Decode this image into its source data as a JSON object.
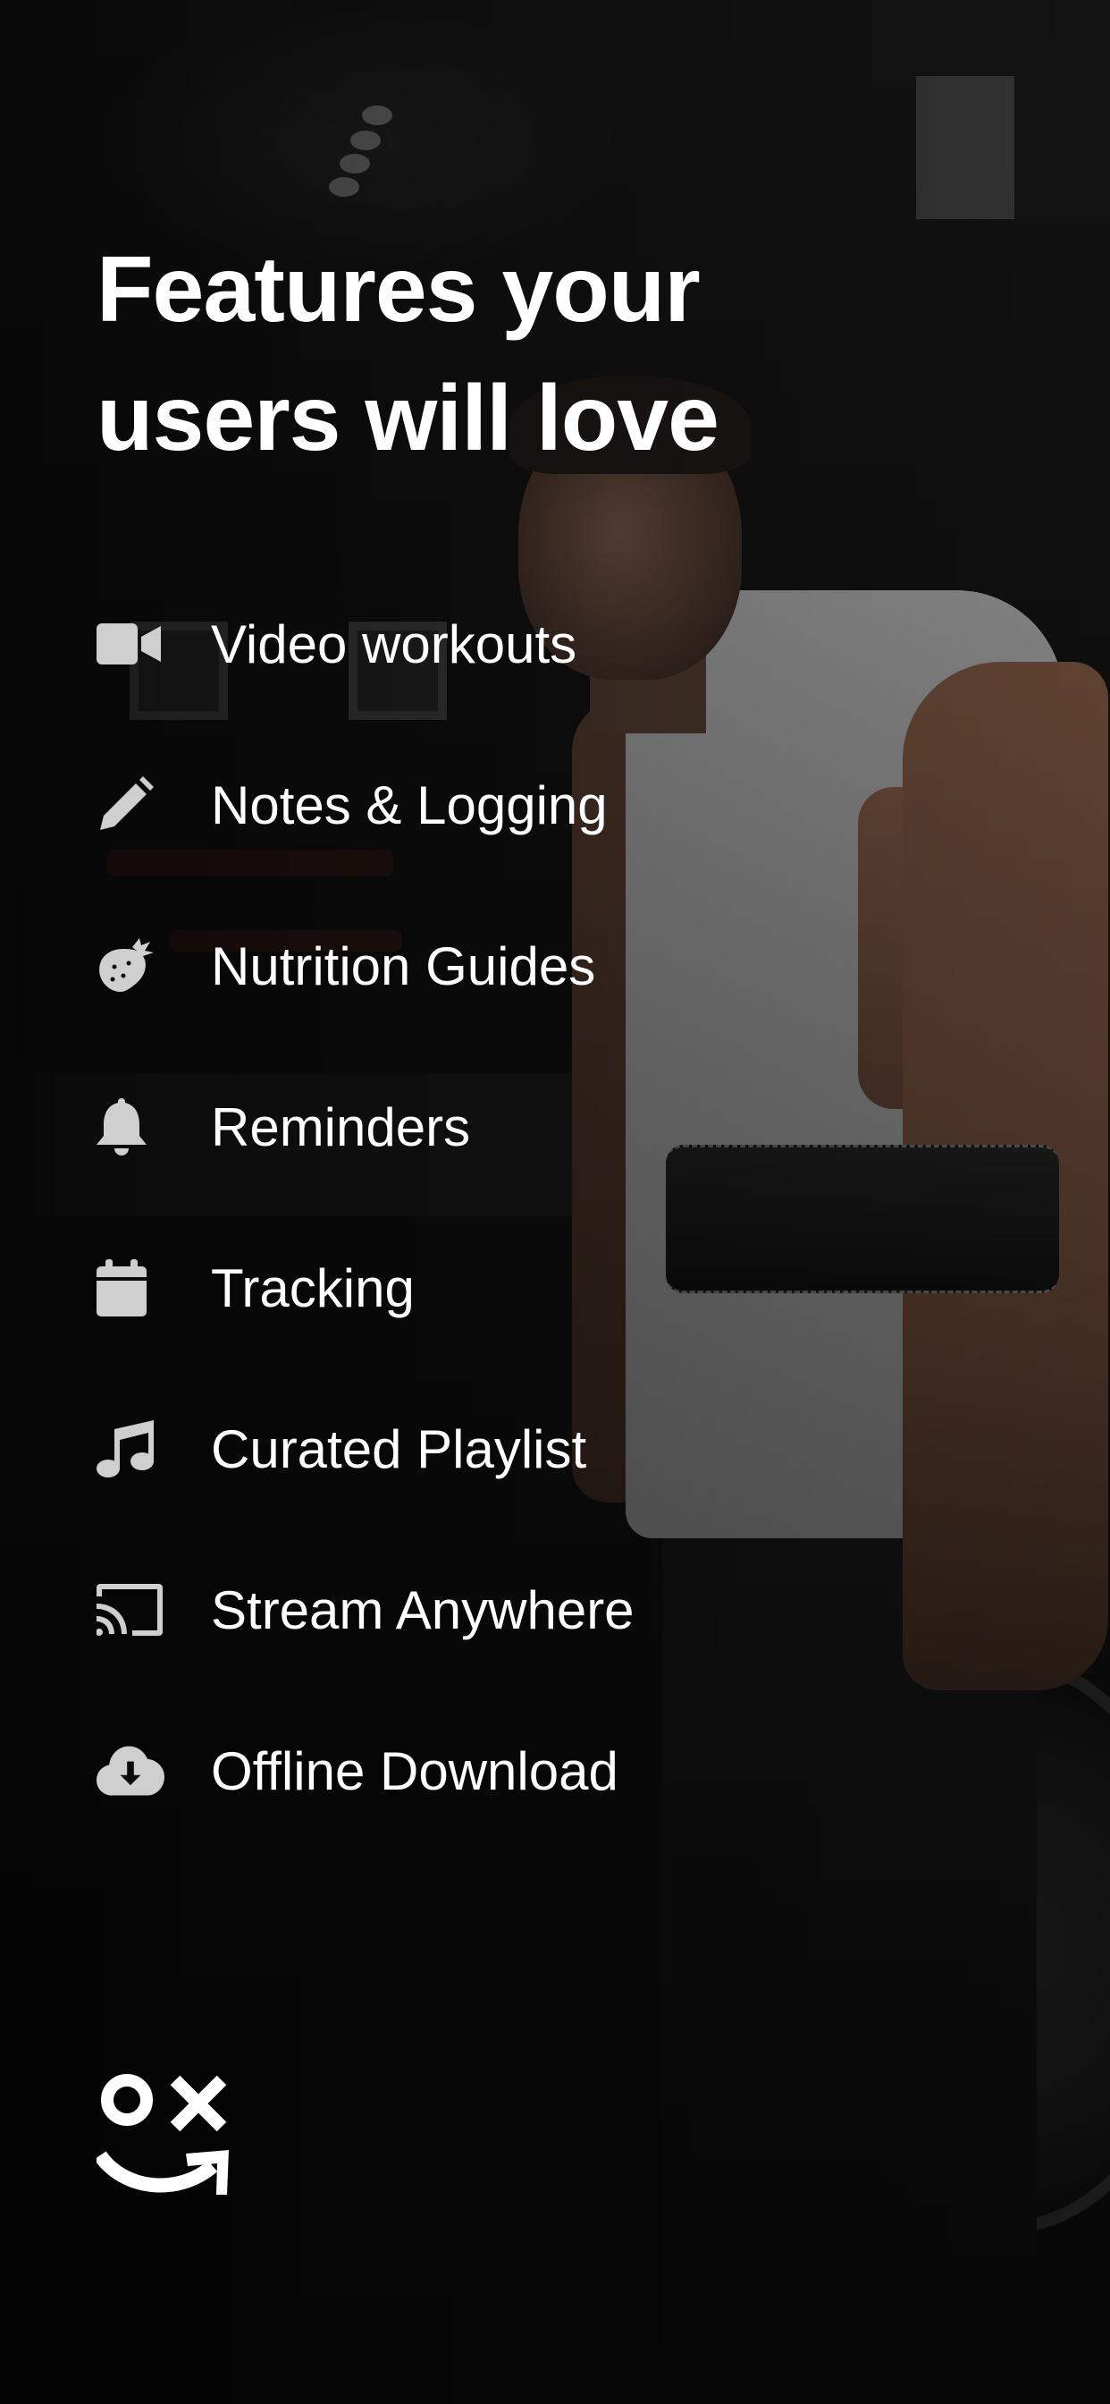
{
  "header": {
    "title_line1": "Features your",
    "title_line2": "users will love"
  },
  "features": [
    {
      "label": "Video workouts",
      "icon": "video-camera-icon"
    },
    {
      "label": "Notes & Logging",
      "icon": "pencil-icon"
    },
    {
      "label": "Nutrition Guides",
      "icon": "strawberry-icon"
    },
    {
      "label": "Reminders",
      "icon": "bell-icon"
    },
    {
      "label": "Tracking",
      "icon": "calendar-icon"
    },
    {
      "label": "Curated Playlist",
      "icon": "music-note-icon"
    },
    {
      "label": "Stream Anywhere",
      "icon": "cast-icon"
    },
    {
      "label": "Offline Download",
      "icon": "cloud-download-icon"
    }
  ],
  "brand": {
    "logo": "brand-logo"
  },
  "colors": {
    "text": "#ffffff",
    "icon": "#cfcfcf",
    "background": "#0b0b0b"
  }
}
